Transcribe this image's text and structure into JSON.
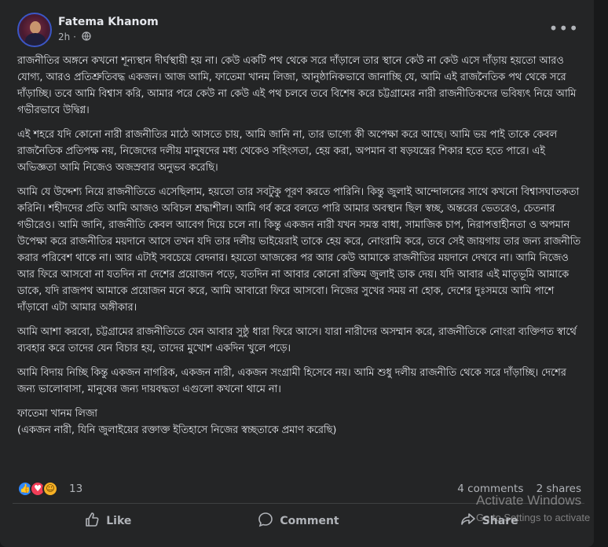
{
  "post": {
    "author": "Fatema Khanom",
    "time": "2h",
    "privacy_icon": "globe-icon",
    "paragraphs": [
      "রাজনীতির অঙ্গনে কখনো শূন্যস্থান দীর্ঘস্থায়ী হয় না। কেউ একটি পথ থেকে সরে দাঁড়ালে তার স্থানে কেউ না কেউ এসে দাঁড়ায় হয়তো আরও যোগ্য, আরও প্রতিশ্রুতিবদ্ধ একজন। আজ আমি, ফাতেমা খানম লিজা, আনুষ্ঠানিকভাবে জানাচ্ছি যে, আমি এই রাজনৈতিক পথ থেকে সরে দাঁড়াচ্ছি। তবে আমি বিশ্বাস করি, আমার পরে কেউ না কেউ এই পথ চলবে তবে বিশেষ করে চট্টগ্রামের নারী রাজনীতিকদের ভবিষ্যৎ নিয়ে আমি গভীরভাবে উদ্বিগ্ন।",
      "এই শহরে যদি কোনো নারী রাজনীতির মাঠে আসতে চায়, আমি জানি না, তার ভাগ্যে কী অপেক্ষা করে আছে। আমি ভয় পাই তাকে কেবল রাজনৈতিক প্রতিপক্ষ নয়, নিজেদের দলীয় মানুষদের মধ্য থেকেও সহিংসতা, হেয় করা, অপমান বা ষড়যন্ত্রের শিকার হতে হতে পারে। এই অভিজ্ঞতা আমি নিজেও অজস্রবার অনুভব করেছি।",
      "আমি যে উদ্দেশ্য নিয়ে রাজনীতিতে এসেছিলাম, হয়তো তার সবটুকু পূরণ করতে পারিনি। কিন্তু জুলাই আন্দোলনের সাথে কখনো বিশ্বাসঘাতকতা করিনি। শহীদদের প্রতি আমি আজও অবিচল শ্রদ্ধাশীল। আমি গর্ব করে বলতে পারি আমার অবস্থান ছিল স্বচ্ছ, অন্তরের ভেতরেও, চেতনার গভীরেও। আমি জানি, রাজনীতি কেবল আবেগ দিয়ে চলে না। কিন্তু একজন নারী যখন সমস্ত বাধা, সামাজিক চাপ, নিরাপত্তাহীনতা ও অপমান উপেক্ষা করে রাজনীতির ময়দানে আসে তখন যদি তার দলীয় ভাইয়েরাই তাকে হেয় করে, নোংরামি করে, তবে সেই জায়গায় তার জন্য রাজনীতি করার পরিবেশ থাকে না। আর এটাই সবচেয়ে বেদনার। হয়তো আজকের পর আর কেউ আমাকে রাজনীতির ময়দানে দেখবে না। আমি নিজেও আর ফিরে আসবো না যতদিন না দেশের প্রয়োজন পড়ে, যতদিন না আবার কোনো রক্তিম জুলাই ডাক দেয়। যদি আবার এই মাতৃভূমি আমাকে ডাকে, যদি রাজপথ আমাকে প্রয়োজন মনে করে, আমি আবারো ফিরে আসবো। নিজের সুখের সময় না হোক, দেশের দুঃসময়ে আমি পাশে দাঁড়াবো এটা আমার অঙ্গীকার।",
      "আমি আশা করবো, চট্টগ্রামের রাজনীতিতে যেন আবার সুষ্ঠু ধারা ফিরে আসে। যারা নারীদের অসম্মান করে, রাজনীতিকে নোংরা ব্যক্তিগত স্বার্থে ব্যবহার করে তাদের যেন বিচার হয়, তাদের মুখোশ একদিন খুলে পড়ে।",
      "আমি বিদায় নিচ্ছি কিন্তু একজন নাগরিক, একজন নারী, একজন সংগ্রামী হিসেবে নয়। আমি শুধু দলীয় রাজনীতি থেকে সরে দাঁড়াচ্ছি। দেশের জন্য ভালোবাসা, মানুষের জন্য দায়বদ্ধতা এগুলো কখনো থামে না।"
    ],
    "signature_name": "ফাতেমা খানম লিজা",
    "signature_note": "(একজন নারী, যিনি জুলাইয়ের রক্তাক্ত ইতিহাসে নিজের স্বচ্ছতাকে প্রমাণ করেছি)"
  },
  "reactions": {
    "count": "13",
    "icons": [
      "like-reaction-icon",
      "love-reaction-icon",
      "haha-reaction-icon"
    ],
    "comments": "4 comments",
    "shares": "2 shares"
  },
  "actions": {
    "like": "Like",
    "comment": "Comment",
    "share": "Share"
  },
  "watermark": {
    "title": "Activate Windows",
    "subtitle": "Go to Settings to activate"
  }
}
